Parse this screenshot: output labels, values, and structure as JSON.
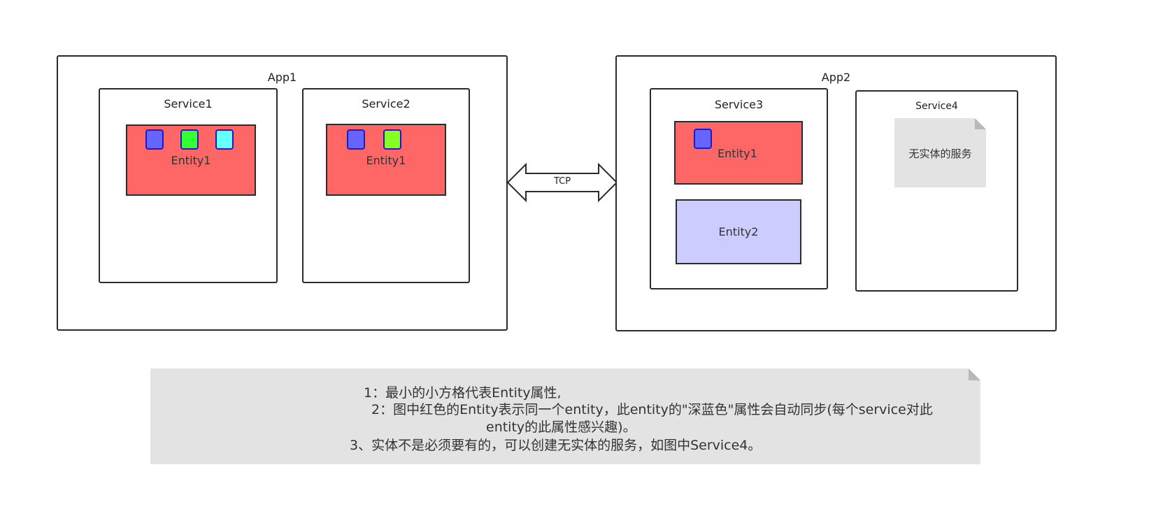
{
  "apps": [
    {
      "title": "App1",
      "services": [
        {
          "title": "Service1",
          "entities": [
            {
              "label": "Entity1",
              "attributes": [
                "#6666ff",
                "#33ff33",
                "#66ffff"
              ]
            }
          ]
        },
        {
          "title": "Service2",
          "entities": [
            {
              "label": "Entity1",
              "attributes": [
                "#6666ff",
                "#88ff22"
              ]
            }
          ]
        }
      ]
    },
    {
      "title": "App2",
      "services": [
        {
          "title": "Service3",
          "entities": [
            {
              "label": "Entity1",
              "attributes": [
                "#6666ff"
              ]
            },
            {
              "label": "Entity2",
              "attributes": []
            }
          ]
        },
        {
          "title": "Service4",
          "note": "无实体的服务"
        }
      ]
    }
  ],
  "connection": {
    "label": "TCP"
  },
  "legend": {
    "lines": [
      "1：最小的小方格代表Entity属性,",
      "2：图中红色的Entity表示同一个entity，此entity的\"深蓝色\"属性会自动同步(每个service对此",
      "entity的此属性感兴趣)。",
      "3、实体不是必须要有的，可以创建无实体的服务，如图中Service4。"
    ]
  },
  "colors": {
    "shared_entity": "#ff6666",
    "entity2": "#ccccff",
    "attribute_border": "#1a1acc",
    "note_background": "#e3e3e3"
  }
}
